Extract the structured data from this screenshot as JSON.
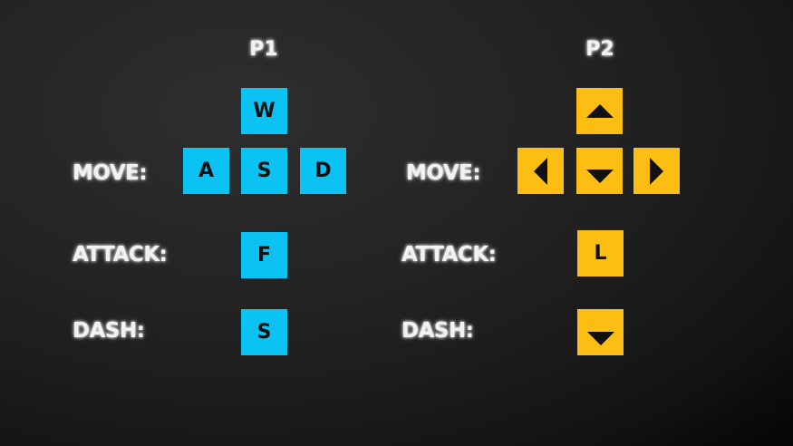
{
  "p1": {
    "title": "P1",
    "move_label": "MOVE:",
    "attack_label": "ATTACK:",
    "dash_label": "DASH:",
    "keys": {
      "up": "W",
      "left": "A",
      "down": "S",
      "right": "D",
      "attack": "F",
      "dash": "S"
    },
    "color": "#0bc3f3"
  },
  "p2": {
    "title": "P2",
    "move_label": "MOVE:",
    "attack_label": "ATTACK:",
    "dash_label": "DASH:",
    "keys": {
      "up": "up-arrow-icon",
      "left": "left-arrow-icon",
      "down": "down-arrow-icon",
      "right": "right-arrow-icon",
      "attack": "L",
      "dash": "down-arrow-icon"
    },
    "color": "#fcbe12"
  }
}
